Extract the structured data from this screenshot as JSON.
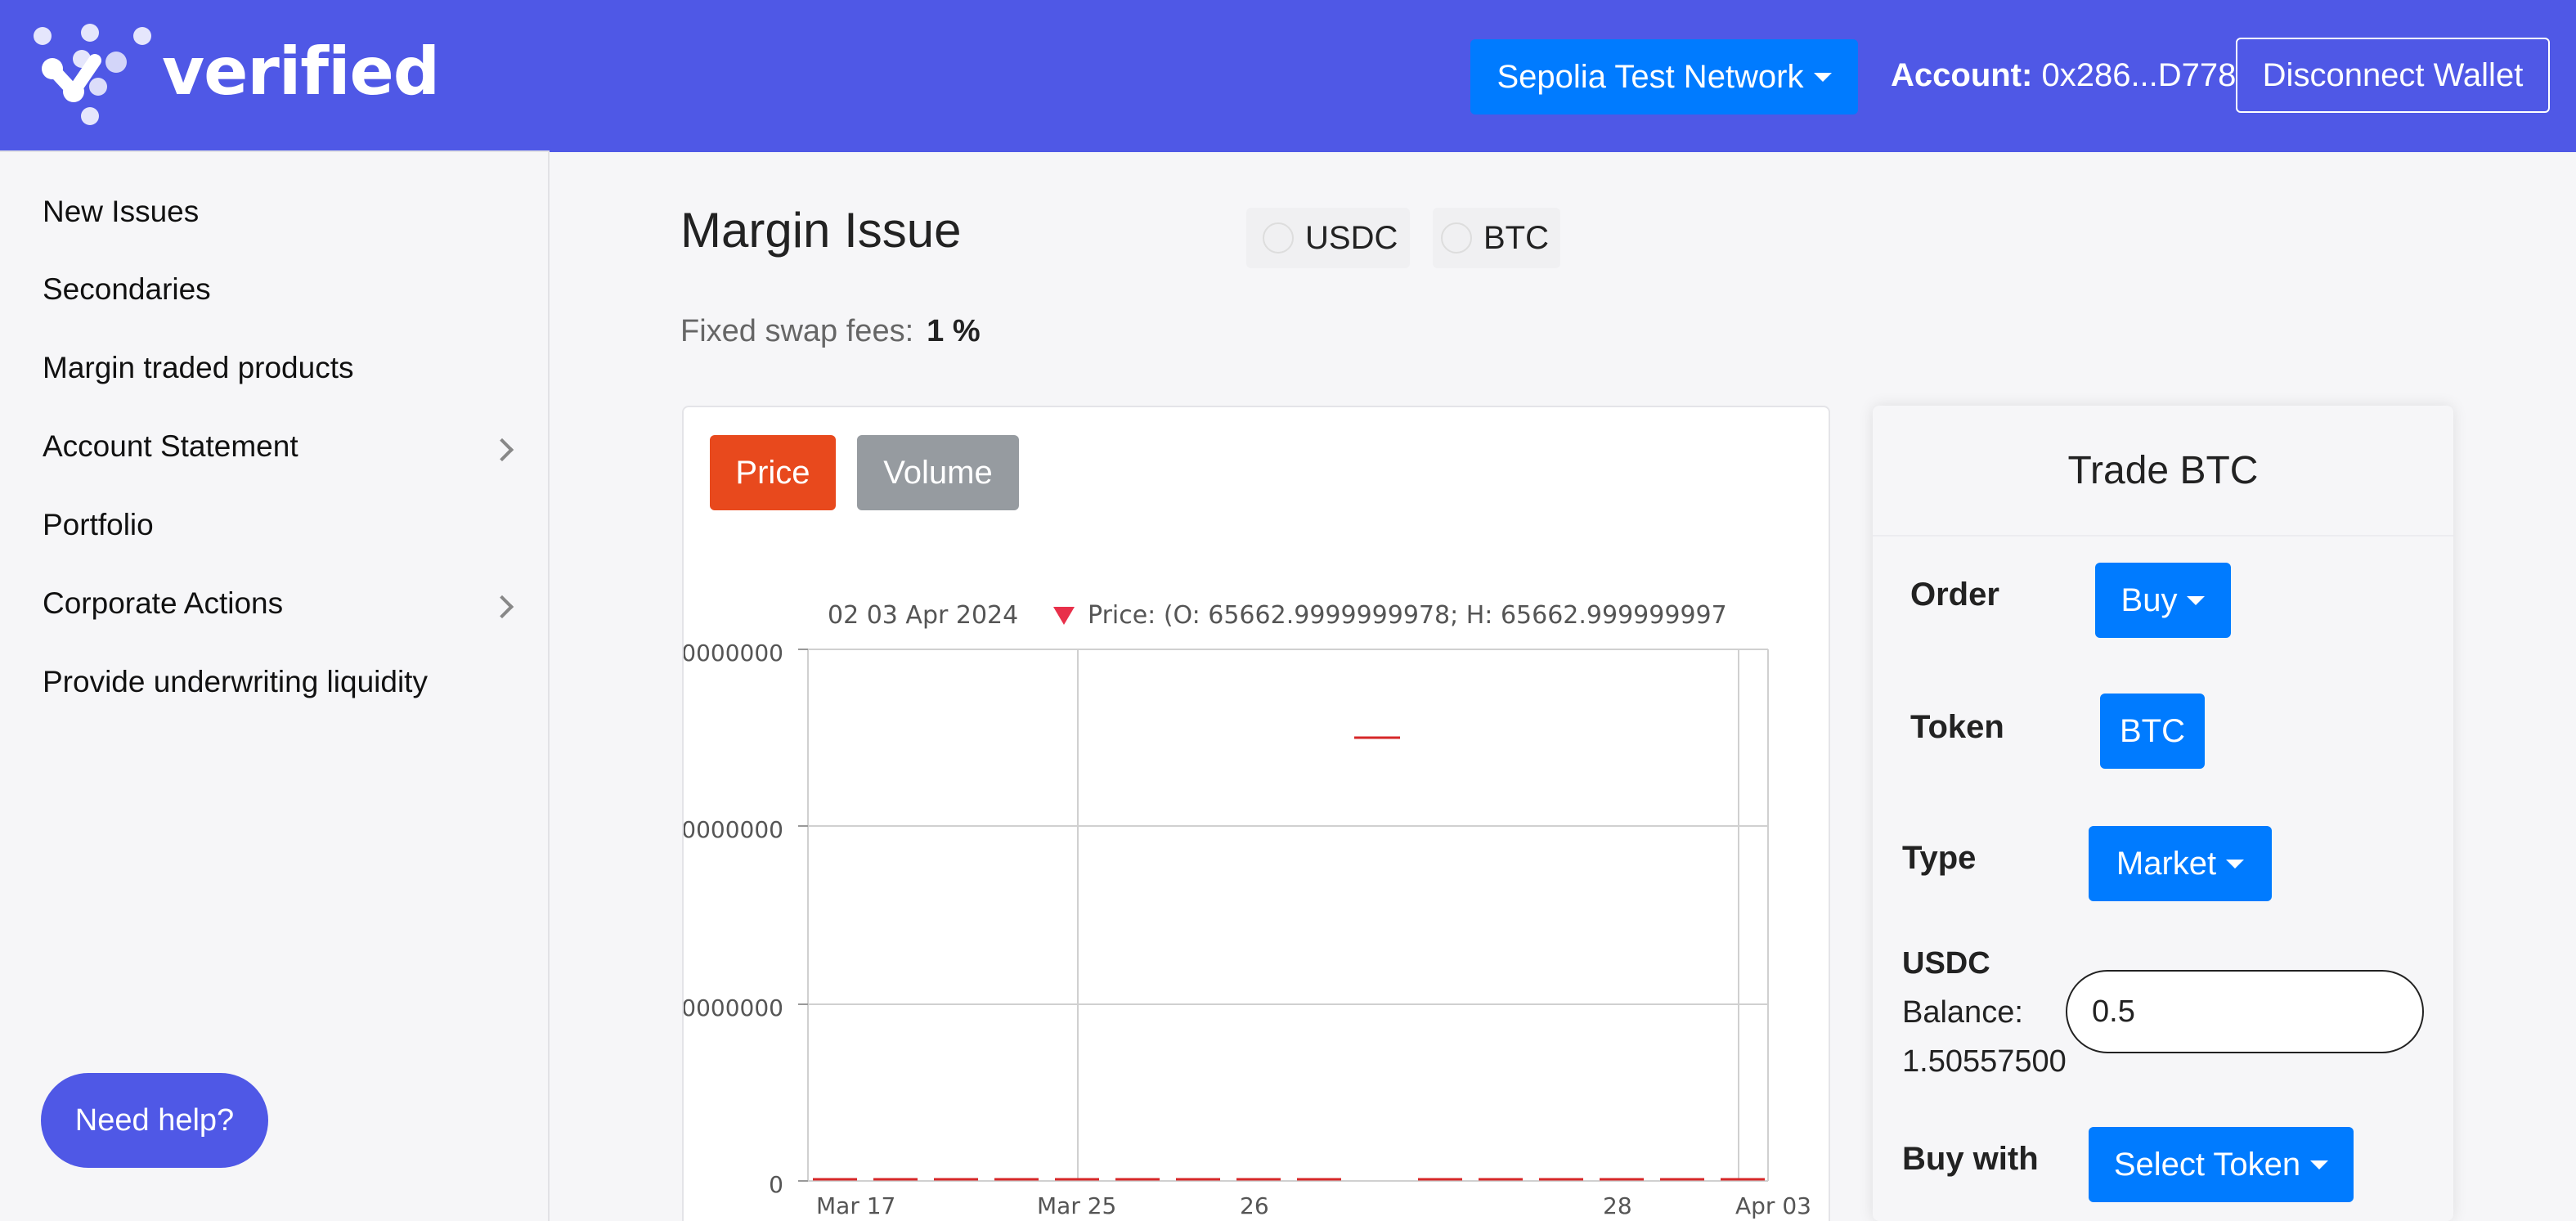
{
  "header": {
    "brand": "verified",
    "network_label": "Sepolia Test Network",
    "account_label": "Account:",
    "account_address": "0x286...D778",
    "disconnect_label": "Disconnect Wallet",
    "bg_color": "#4f58e6"
  },
  "sidebar": {
    "items": [
      {
        "label": "New Issues"
      },
      {
        "label": "Secondaries"
      },
      {
        "label": "Margin traded products"
      },
      {
        "label": "Account Statement",
        "has_submenu": true
      },
      {
        "label": "Portfolio"
      },
      {
        "label": "Corporate Actions",
        "has_submenu": true
      },
      {
        "label": "Provide underwriting liquidity"
      }
    ],
    "help_label": "Need help?"
  },
  "main": {
    "title": "Margin Issue",
    "chips": [
      "USDC",
      "BTC"
    ],
    "fees_label": "Fixed swap fees:",
    "fees_value": "1 %",
    "tabs": [
      {
        "label": "Price",
        "active": true,
        "color": "#e8491d"
      },
      {
        "label": "Volume",
        "active": false,
        "color": "#969ba0"
      }
    ]
  },
  "chart_data": {
    "type": "line",
    "legend_date": "02 03 Apr 2024",
    "legend_text": "Price: (O: 65662.9999999978; H: 65662.999999997",
    "ytick_labels": [
      "0000000",
      "0000000",
      "0000000",
      "0"
    ],
    "xtick_labels": [
      "Mar 17",
      "Mar 25",
      "26",
      "28",
      "Apr 03"
    ],
    "series": [
      {
        "color": "#d62728"
      }
    ],
    "grid": true
  },
  "trade": {
    "title": "Trade BTC",
    "order_label": "Order",
    "order_value": "Buy",
    "token_label": "Token",
    "token_value": "BTC",
    "type_label": "Type",
    "type_value": "Market",
    "balance_token": "USDC",
    "balance_label": "Balance:",
    "balance_value": "1.50557500",
    "amount_value": "0.5",
    "buy_with_label": "Buy with",
    "buy_with_value": "Select Token",
    "accent": "#007bff"
  }
}
